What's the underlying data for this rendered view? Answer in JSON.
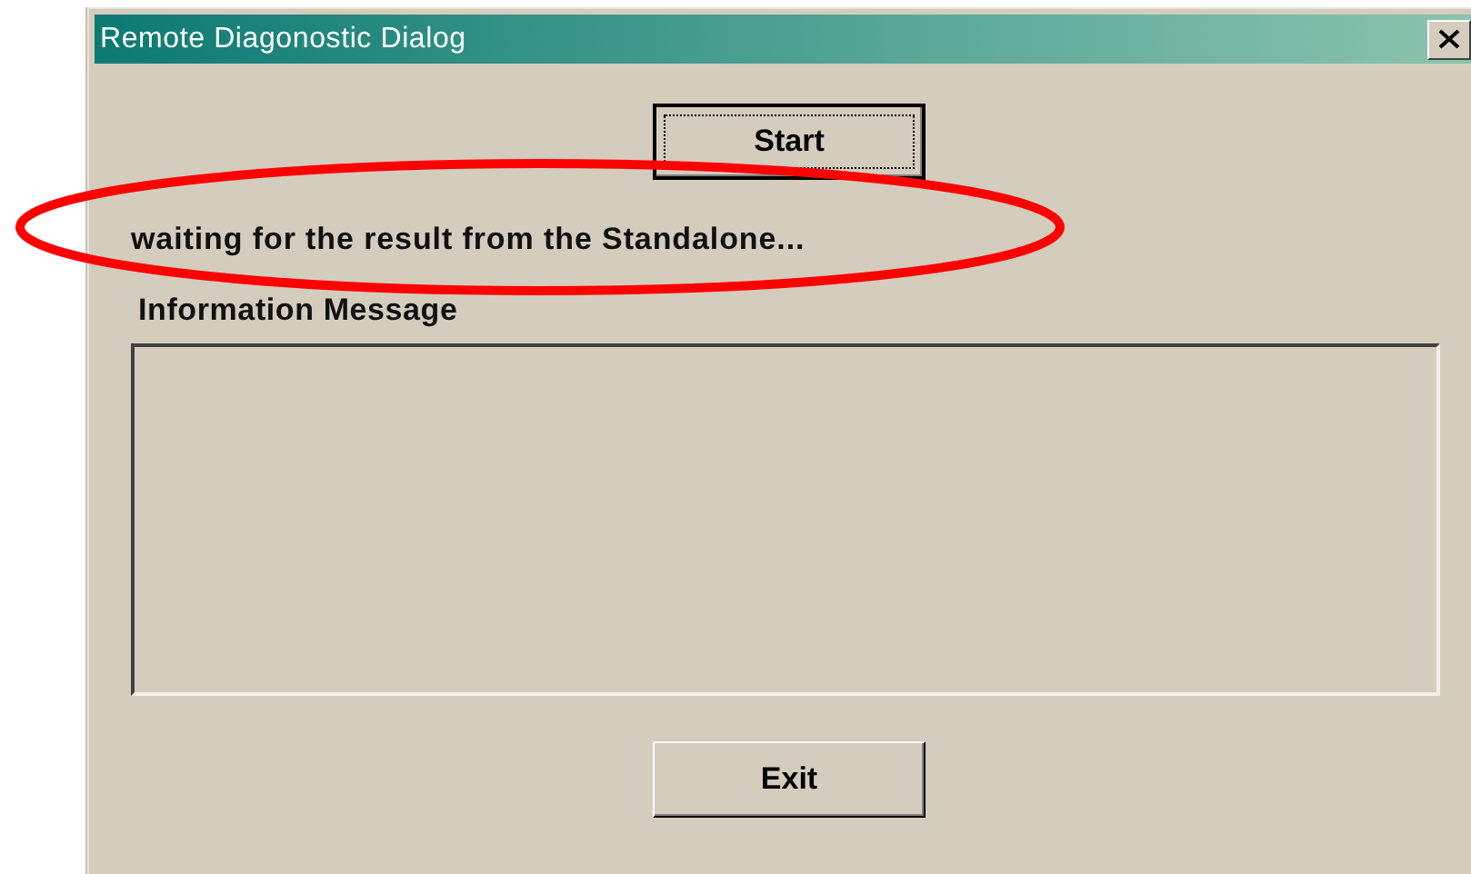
{
  "window": {
    "title": "Remote Diagonostic Dialog"
  },
  "start_button": {
    "label": "Start",
    "focused": true
  },
  "status_message": "waiting for the result from the Standalone...",
  "information_message": {
    "label": "Information Message"
  },
  "exit_button": {
    "label": "Exit",
    "focused": false
  }
}
